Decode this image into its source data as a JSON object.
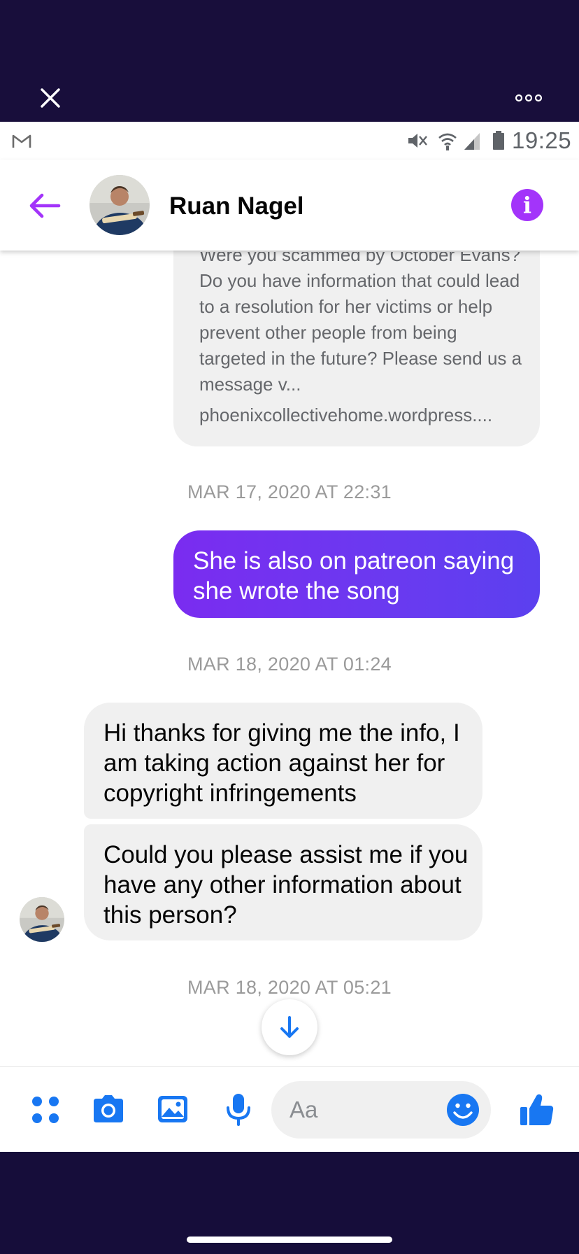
{
  "status_bar": {
    "time": "19:25"
  },
  "header": {
    "contact_name": "Ruan Nagel",
    "info_glyph": "i"
  },
  "messages": {
    "link_preview": {
      "text": "Were you scammed by October Evans? Do you have information that could lead to a resolution for her victims or help prevent other people from being targeted in the future? Please send us a message v...",
      "domain": "phoenixcollectivehome.wordpress...."
    },
    "timestamps": [
      "MAR 17, 2020 AT 22:31",
      "MAR 18, 2020 AT 01:24",
      "MAR 18, 2020 AT 05:21"
    ],
    "outgoing": [
      "She is also on patreon saying she wrote the song"
    ],
    "incoming": [
      "Hi thanks for giving me the info, I am taking action against her for copyright infringements",
      "Could you please assist me if you  have any other information about this person?"
    ]
  },
  "composer": {
    "placeholder": "Aa"
  },
  "colors": {
    "accent_purple": "#a334fa",
    "bubble_out_start": "#7a2cf0",
    "bubble_out_end": "#5b40ef",
    "icon_blue": "#1877f2",
    "overlay_dark": "#180e3b"
  },
  "icons": [
    "close-icon",
    "more-icon",
    "gmail-icon",
    "mute-icon",
    "wifi-icon",
    "signal-icon",
    "battery-icon",
    "back-arrow-icon",
    "info-icon",
    "arrow-down-icon",
    "menu-dots-icon",
    "camera-icon",
    "gallery-icon",
    "mic-icon",
    "emoji-icon",
    "like-icon"
  ]
}
